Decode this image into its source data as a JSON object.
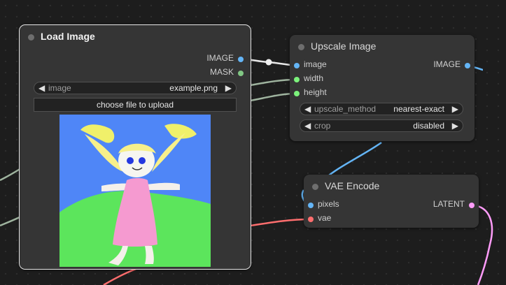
{
  "colors": {
    "image": "#64b5f6",
    "mask": "#81c784",
    "int": "#7cf27c",
    "vae": "#ff6e6e",
    "latent": "#ff9cf9"
  },
  "load_image": {
    "title": "Load Image",
    "outputs": {
      "image": "IMAGE",
      "mask": "MASK"
    },
    "image_widget": {
      "label": "image",
      "value": "example.png"
    },
    "upload_button": "choose file to upload",
    "preview_name": "image-preview"
  },
  "upscale": {
    "title": "Upscale Image",
    "inputs": {
      "image": "image",
      "width": "width",
      "height": "height"
    },
    "output": "IMAGE",
    "upscale_method": {
      "label": "upscale_method",
      "value": "nearest-exact"
    },
    "crop": {
      "label": "crop",
      "value": "disabled"
    }
  },
  "vae_encode": {
    "title": "VAE Encode",
    "inputs": {
      "pixels": "pixels",
      "vae": "vae"
    },
    "output": "LATENT"
  },
  "glyphs": {
    "left": "◀",
    "right": "▶"
  }
}
